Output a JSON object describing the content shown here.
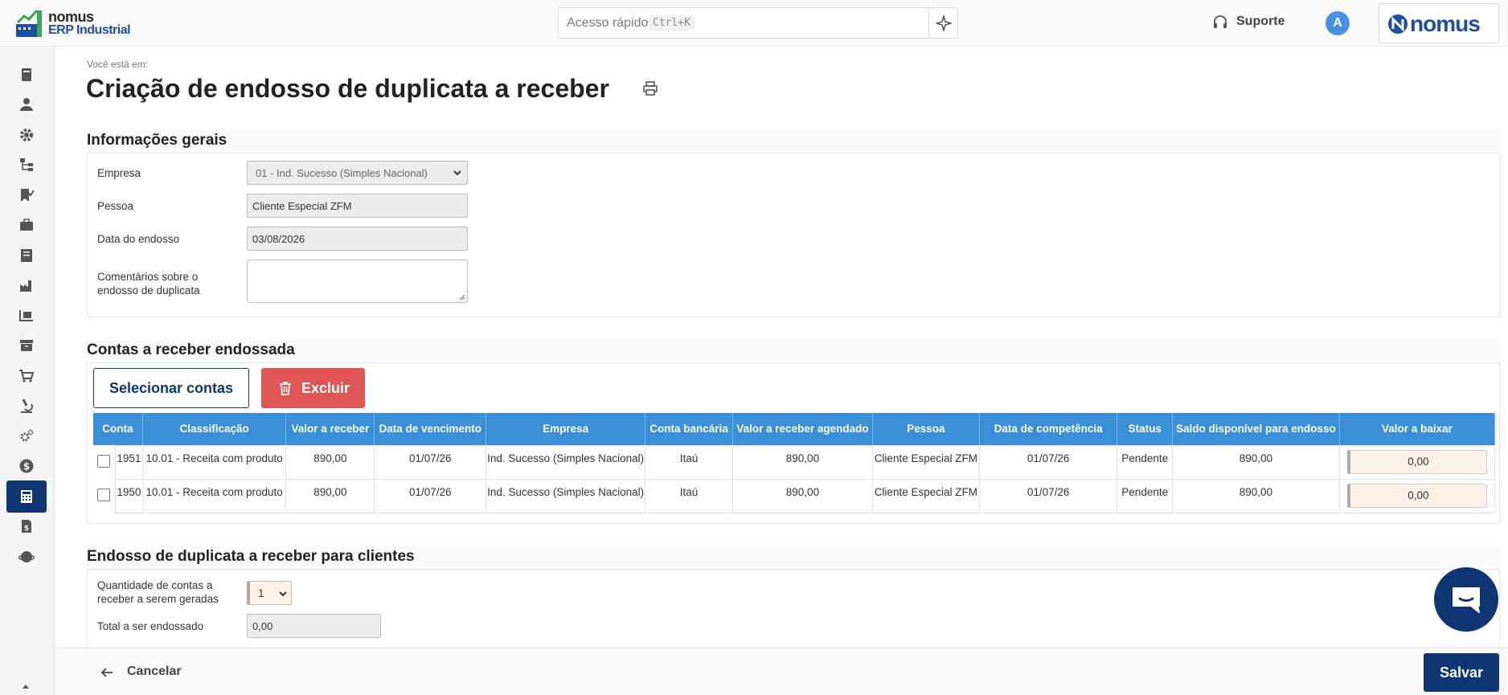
{
  "app": {
    "logo_line1": "nomus",
    "logo_line2": "ERP Industrial",
    "brand": "nomus",
    "avatar_initial": "A"
  },
  "header": {
    "search_placeholder": "Acesso rápido",
    "search_shortcut": "Ctrl+K",
    "support_label": "Suporte"
  },
  "sidebar": {
    "items": [
      {
        "icon": "book-icon"
      },
      {
        "icon": "user-icon"
      },
      {
        "icon": "gear-icon"
      },
      {
        "icon": "hierarchy-icon"
      },
      {
        "icon": "bookmark-check-icon"
      },
      {
        "icon": "briefcase-icon"
      },
      {
        "icon": "notebook-icon"
      },
      {
        "icon": "factory-icon"
      },
      {
        "icon": "forklift-icon"
      },
      {
        "icon": "archive-icon"
      },
      {
        "icon": "cart-icon"
      },
      {
        "icon": "microscope-icon"
      },
      {
        "icon": "gears-icon"
      },
      {
        "icon": "dollar-icon"
      },
      {
        "icon": "calculator-icon",
        "active": true
      },
      {
        "icon": "invoice-icon"
      },
      {
        "icon": "globe-icon"
      }
    ]
  },
  "page": {
    "breadcrumb": "Você está em:",
    "title": "Criação de endosso de duplicata a receber"
  },
  "general": {
    "section_title": "Informações gerais",
    "empresa_label": "Empresa",
    "empresa_value": "01 - Ind. Sucesso (Simples Nacional)",
    "pessoa_label": "Pessoa",
    "pessoa_value": "Cliente Especial ZFM",
    "data_label": "Data do endosso",
    "data_value": "03/08/2026",
    "comentarios_label_1": "Comentários sobre o",
    "comentarios_label_2": "endosso de duplicata",
    "comentarios_value": ""
  },
  "contas": {
    "section_title": "Contas a receber endossada",
    "select_button": "Selecionar contas",
    "delete_button": "Excluir",
    "columns": [
      "Conta",
      "Classificação",
      "Valor a receber",
      "Data de vencimento",
      "Empresa",
      "Conta bancária",
      "Valor a receber agendado",
      "Pessoa",
      "Data de competência",
      "Status",
      "Saldo disponível para endosso",
      "Valor a baixar"
    ],
    "rows": [
      {
        "conta": "1951",
        "classificacao": "10.01 - Receita com produto",
        "valor": "890,00",
        "vencimento": "01/07/26",
        "empresa": "Ind. Sucesso (Simples Nacional)",
        "banco": "Itaú",
        "agendado": "890,00",
        "pessoa": "Cliente Especial ZFM",
        "competencia": "01/07/26",
        "status": "Pendente",
        "saldo": "890,00",
        "baixar": "0,00"
      },
      {
        "conta": "1950",
        "classificacao": "10.01 - Receita com produto",
        "valor": "890,00",
        "vencimento": "01/07/26",
        "empresa": "Ind. Sucesso (Simples Nacional)",
        "banco": "Itaú",
        "agendado": "890,00",
        "pessoa": "Cliente Especial ZFM",
        "competencia": "01/07/26",
        "status": "Pendente",
        "saldo": "890,00",
        "baixar": "0,00"
      }
    ]
  },
  "endosso": {
    "section_title": "Endosso de duplicata a receber para clientes",
    "quantidade_label_1": "Quantidade de contas a",
    "quantidade_label_2": "receber a serem geradas",
    "quantidade_value": "1",
    "total_label": "Total a ser endossado",
    "total_value": "0,00"
  },
  "footer": {
    "cancel_label": "Cancelar",
    "save_label": "Salvar"
  },
  "colors": {
    "primary": "#0f3573",
    "table_header": "#3a8fd6",
    "danger": "#e05555",
    "avatar": "#4a90e2"
  }
}
